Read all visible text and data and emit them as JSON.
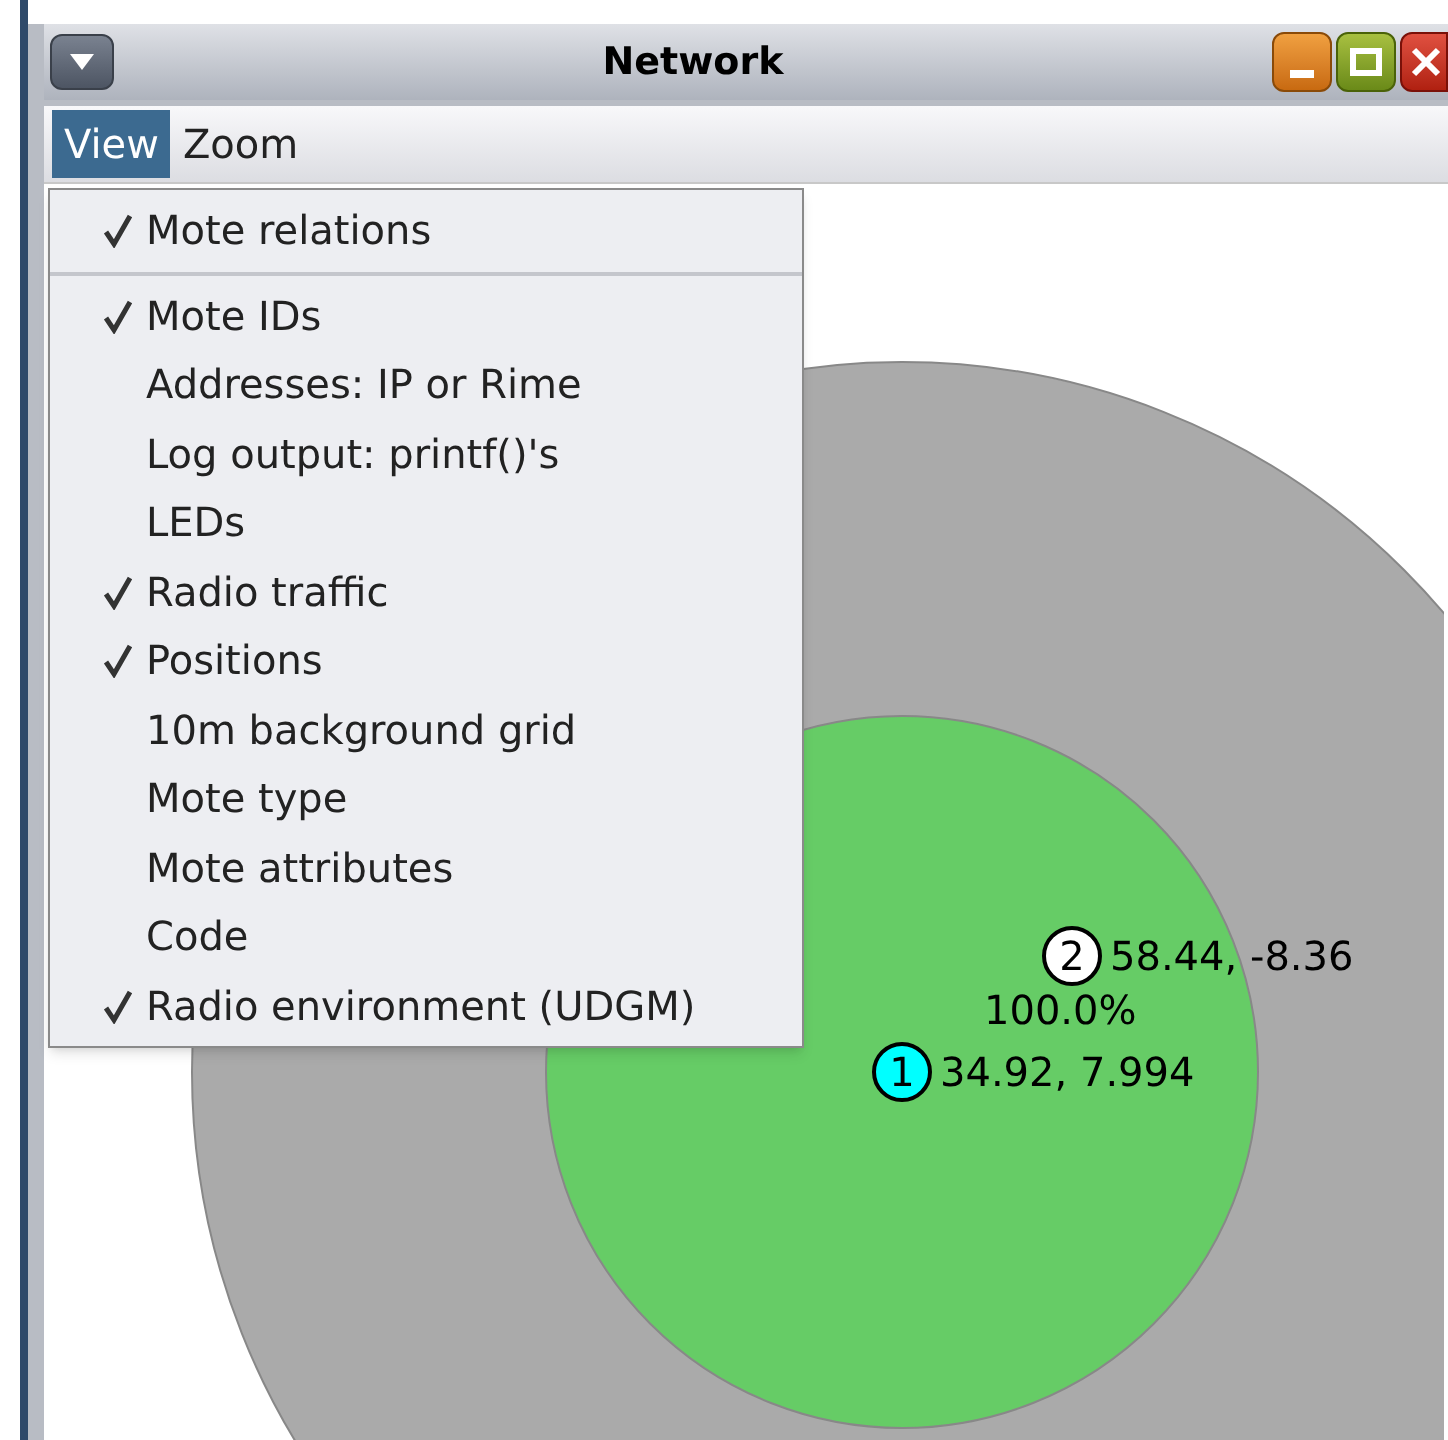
{
  "window": {
    "title": "Network"
  },
  "menus": [
    {
      "label": "View",
      "selected": true
    },
    {
      "label": "Zoom",
      "selected": false
    }
  ],
  "view_menu": {
    "groups": [
      [
        {
          "label": "Mote relations",
          "checked": true
        }
      ],
      [
        {
          "label": "Mote IDs",
          "checked": true
        },
        {
          "label": "Addresses: IP or Rime",
          "checked": false
        },
        {
          "label": "Log output: printf()'s",
          "checked": false
        },
        {
          "label": "LEDs",
          "checked": false
        },
        {
          "label": "Radio traffic",
          "checked": true
        },
        {
          "label": "Positions",
          "checked": true
        },
        {
          "label": "10m background grid",
          "checked": false
        },
        {
          "label": "Mote type",
          "checked": false
        },
        {
          "label": "Mote attributes",
          "checked": false
        },
        {
          "label": "Code",
          "checked": false
        },
        {
          "label": "Radio environment (UDGM)",
          "checked": true
        }
      ]
    ]
  },
  "motes": [
    {
      "id": "2",
      "position": "58.44, -8.36",
      "color": "#ffffff"
    },
    {
      "id": "1",
      "position": "34.92, 7.994",
      "color": "#00ffff"
    }
  ],
  "link_label": "100.0%"
}
